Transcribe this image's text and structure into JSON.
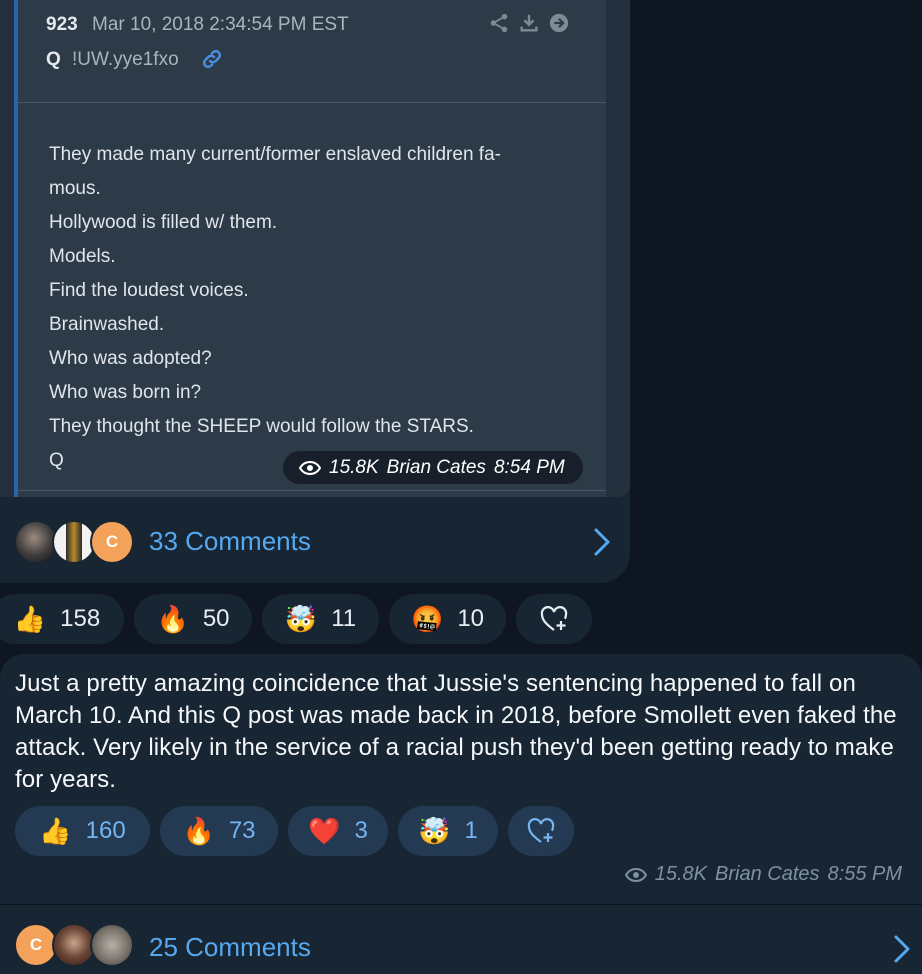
{
  "post1": {
    "image": {
      "number": "923",
      "date": "Mar 10, 2018 2:34:54 PM EST",
      "author": "Q",
      "tripcode": "!UW.yye1fxo",
      "body_lines": [
        "They made many current/former enslaved children fa-",
        "mous.",
        "Hollywood is filled w/ them.",
        "Models.",
        "Find the loudest voices.",
        "Brainwashed.",
        "Who was adopted?",
        "Who was born in?",
        "They thought the SHEEP would follow the STARS.",
        "Q"
      ]
    },
    "views": "15.8K",
    "author": "Brian Cates",
    "time": "8:54 PM",
    "comments_label": "33 Comments",
    "avatar_letter": "C",
    "reactions": [
      {
        "emoji": "👍",
        "count": "158",
        "icon": "thumbs-up-icon"
      },
      {
        "emoji": "🔥",
        "count": "50",
        "icon": "fire-icon"
      },
      {
        "emoji": "🤯",
        "count": "11",
        "icon": "exploding-head-icon"
      },
      {
        "emoji": "🤬",
        "count": "10",
        "icon": "cursing-face-icon"
      }
    ]
  },
  "post2": {
    "text": "Just a pretty amazing coincidence that Jussie's sentencing happened to fall on March 10. And this Q post was made back in 2018, before Smollett even faked the attack.  Very likely in the service of a racial push they'd been getting ready to make for years.",
    "reactions": [
      {
        "emoji": "👍",
        "count": "160",
        "icon": "thumbs-up-icon"
      },
      {
        "emoji": "🔥",
        "count": "73",
        "icon": "fire-icon"
      },
      {
        "emoji": "❤️",
        "count": "3",
        "icon": "heart-icon"
      },
      {
        "emoji": "🤯",
        "count": "1",
        "icon": "exploding-head-icon"
      }
    ],
    "views": "15.8K",
    "author": "Brian Cates",
    "time": "8:55 PM",
    "comments_label": "25 Comments",
    "avatar_letter": "C"
  },
  "colors": {
    "background": "#0e1621",
    "bubble": "#182533",
    "accent_blue": "#55a9f0",
    "post_border": "#2b63b4"
  }
}
